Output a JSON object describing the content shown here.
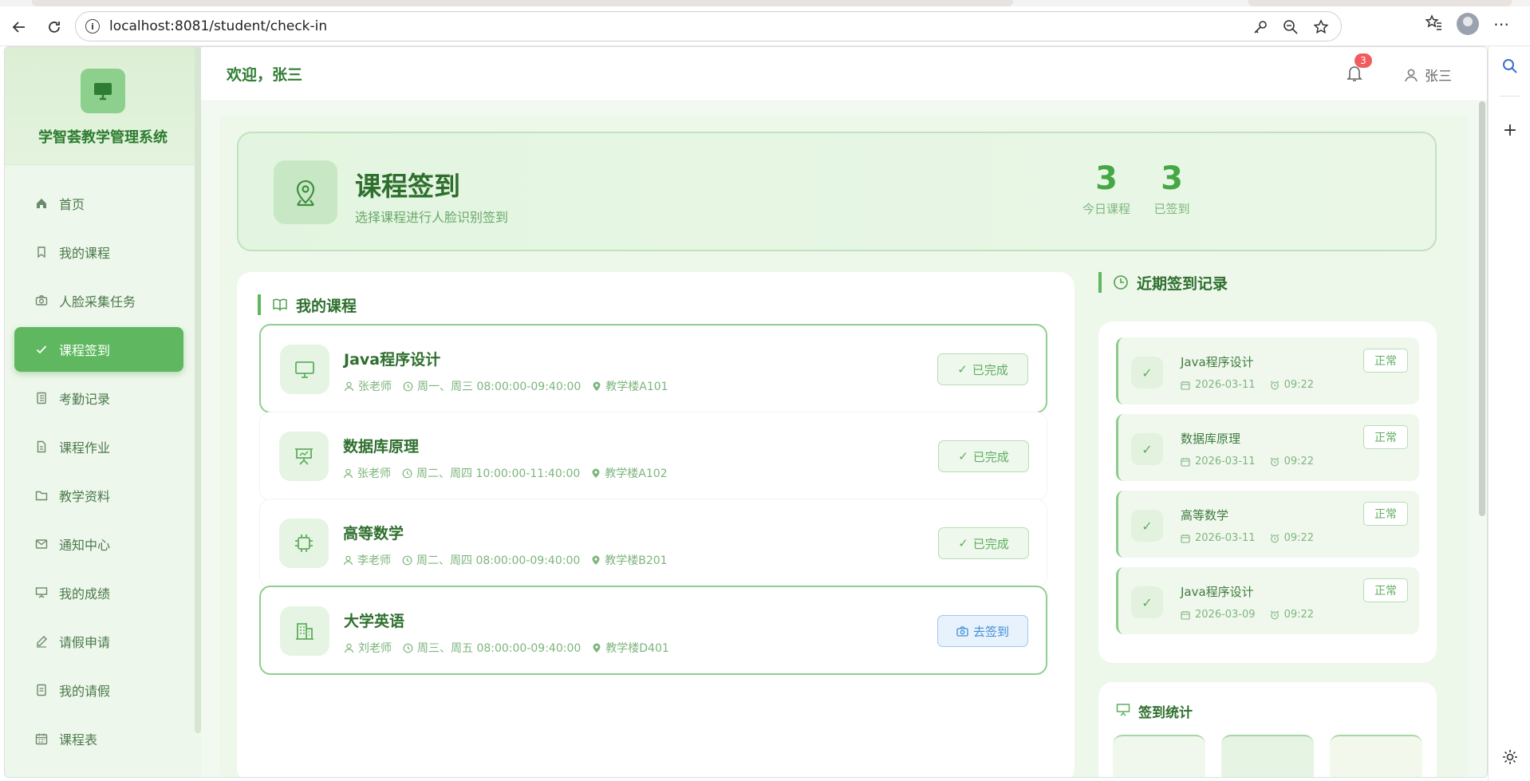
{
  "browser": {
    "url": "localhost:8081/student/check-in"
  },
  "app": {
    "brand_title": "学智荟教学管理系统",
    "welcome": "欢迎，张三",
    "notification_count": "3",
    "user_name": "张三"
  },
  "sidebar": {
    "items": [
      {
        "label": "首页",
        "icon": "home-icon"
      },
      {
        "label": "我的课程",
        "icon": "bookmark-icon"
      },
      {
        "label": "人脸采集任务",
        "icon": "camera-icon"
      },
      {
        "label": "课程签到",
        "icon": "check-icon",
        "active": true
      },
      {
        "label": "考勤记录",
        "icon": "notebook-icon"
      },
      {
        "label": "课程作业",
        "icon": "document-icon"
      },
      {
        "label": "教学资料",
        "icon": "folder-icon"
      },
      {
        "label": "通知中心",
        "icon": "mail-icon"
      },
      {
        "label": "我的成绩",
        "icon": "presentation-icon"
      },
      {
        "label": "请假申请",
        "icon": "pen-icon"
      },
      {
        "label": "我的请假",
        "icon": "list-icon"
      },
      {
        "label": "课程表",
        "icon": "calendar-icon"
      }
    ]
  },
  "hero": {
    "title": "课程签到",
    "subtitle": "选择课程进行人脸识别签到",
    "stats": [
      {
        "value": "3",
        "label": "今日课程"
      },
      {
        "value": "3",
        "label": "已签到"
      }
    ]
  },
  "courses": {
    "heading": "我的课程",
    "items": [
      {
        "name": "Java程序设计",
        "teacher": "张老师",
        "time": "周一、周三 08:00:00-09:40:00",
        "location": "教学楼A101",
        "action": "已完成",
        "status": "done",
        "icon": "monitor-icon"
      },
      {
        "name": "数据库原理",
        "teacher": "张老师",
        "time": "周二、周四 10:00:00-11:40:00",
        "location": "教学楼A102",
        "action": "已完成",
        "status": "done",
        "icon": "presentation-icon"
      },
      {
        "name": "高等数学",
        "teacher": "李老师",
        "time": "周二、周四 08:00:00-09:40:00",
        "location": "教学楼B201",
        "action": "已完成",
        "status": "done",
        "icon": "chip-icon"
      },
      {
        "name": "大学英语",
        "teacher": "刘老师",
        "time": "周三、周五 08:00:00-09:40:00",
        "location": "教学楼D401",
        "action": "去签到",
        "status": "go",
        "icon": "building-icon"
      }
    ]
  },
  "records": {
    "heading": "近期签到记录",
    "items": [
      {
        "course": "Java程序设计",
        "date": "2026-03-11",
        "time": "09:22",
        "status": "正常"
      },
      {
        "course": "数据库原理",
        "date": "2026-03-11",
        "time": "09:22",
        "status": "正常"
      },
      {
        "course": "高等数学",
        "date": "2026-03-11",
        "time": "09:22",
        "status": "正常"
      },
      {
        "course": "Java程序设计",
        "date": "2026-03-09",
        "time": "09:22",
        "status": "正常"
      }
    ]
  },
  "stats_box": {
    "heading": "签到统计"
  },
  "colors": {
    "accent": "#5fb85f",
    "primary_text": "#2e6f2e",
    "go_button": "#3e8fd6"
  }
}
